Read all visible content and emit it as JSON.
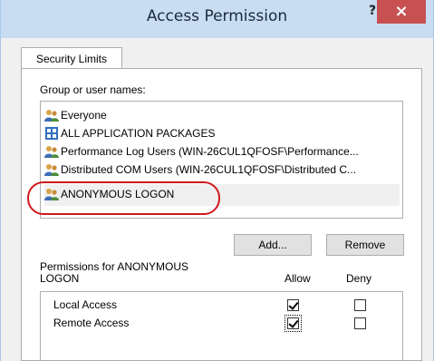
{
  "window": {
    "title": "Access Permission",
    "help_label": "?",
    "close_label": "×"
  },
  "tabs": [
    {
      "label": "Security Limits"
    }
  ],
  "group_section": {
    "label": "Group or user names:",
    "items": [
      {
        "label": "Everyone",
        "icon": "users-icon"
      },
      {
        "label": "ALL APPLICATION PACKAGES",
        "icon": "packages-icon"
      },
      {
        "label": "Performance Log Users (WIN-26CUL1QFOSF\\Performance...",
        "icon": "users-icon"
      },
      {
        "label": "Distributed COM Users (WIN-26CUL1QFOSF\\Distributed C...",
        "icon": "users-icon"
      },
      {
        "label": "ANONYMOUS LOGON",
        "icon": "users-icon",
        "selected": true
      }
    ]
  },
  "buttons": {
    "add": "Add...",
    "remove": "Remove"
  },
  "permissions": {
    "label_line1": "Permissions for ANONYMOUS",
    "label_line2": "LOGON",
    "allow_header": "Allow",
    "deny_header": "Deny",
    "rows": [
      {
        "label": "Local Access",
        "allow": true,
        "deny": false
      },
      {
        "label": "Remote Access",
        "allow": true,
        "deny": false
      }
    ]
  },
  "colors": {
    "highlight_ring": "#d0191d",
    "close_button": "#c75050",
    "titlebar": "#c8ddf2"
  }
}
